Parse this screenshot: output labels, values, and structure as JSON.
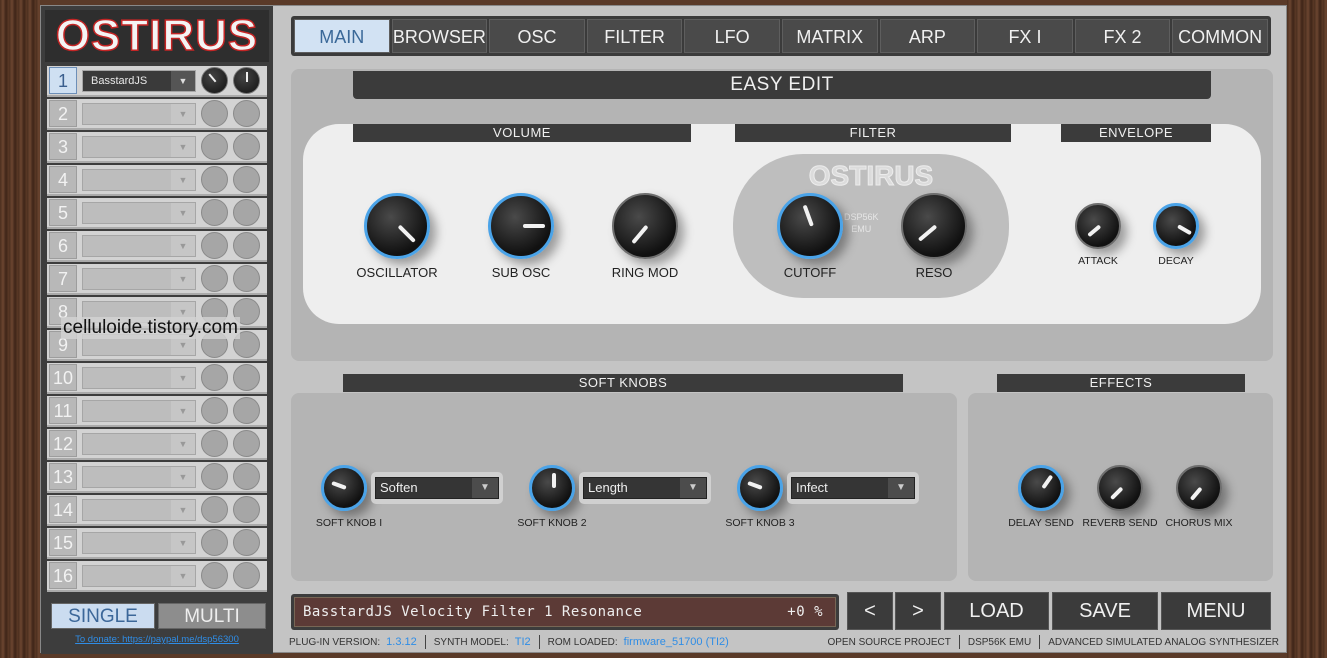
{
  "app": {
    "logo": "OSTIRUS"
  },
  "parts": [
    {
      "num": "1",
      "preset": "BasstardJS"
    },
    {
      "num": "2",
      "preset": ""
    },
    {
      "num": "3",
      "preset": ""
    },
    {
      "num": "4",
      "preset": ""
    },
    {
      "num": "5",
      "preset": ""
    },
    {
      "num": "6",
      "preset": ""
    },
    {
      "num": "7",
      "preset": ""
    },
    {
      "num": "8",
      "preset": ""
    },
    {
      "num": "9",
      "preset": ""
    },
    {
      "num": "10",
      "preset": ""
    },
    {
      "num": "11",
      "preset": ""
    },
    {
      "num": "12",
      "preset": ""
    },
    {
      "num": "13",
      "preset": ""
    },
    {
      "num": "14",
      "preset": ""
    },
    {
      "num": "15",
      "preset": ""
    },
    {
      "num": "16",
      "preset": ""
    }
  ],
  "watermark": "celluloide.tistory.com",
  "mode": {
    "single": "SINGLE",
    "multi": "MULTI"
  },
  "donate": "To donate: https://paypal.me/dsp56300",
  "tabs": [
    "MAIN",
    "BROWSER",
    "OSC",
    "FILTER",
    "LFO",
    "MATRIX",
    "ARP",
    "FX I",
    "FX 2",
    "COMMON"
  ],
  "easy_edit": {
    "title": "EASY EDIT",
    "volume": "VOLUME",
    "filter": "FILTER",
    "envelope": "ENVELOPE",
    "knobs": {
      "oscillator": "OSCILLATOR",
      "sub_osc": "SUB OSC",
      "ring_mod": "RING MOD",
      "cutoff": "CUTOFF",
      "reso": "RESO",
      "attack": "ATTACK",
      "decay": "DECAY"
    },
    "filter_logo": "OSTIRUS",
    "dsp_line1": "DSP56K",
    "dsp_line2": "EMU"
  },
  "soft_knobs": {
    "title": "SOFT KNOBS",
    "k1": {
      "label": "SOFT KNOB I",
      "value": "Soften"
    },
    "k2": {
      "label": "SOFT KNOB 2",
      "value": "Length"
    },
    "k3": {
      "label": "SOFT KNOB 3",
      "value": "Infect"
    }
  },
  "effects": {
    "title": "EFFECTS",
    "delay": "DELAY SEND",
    "reverb": "REVERB SEND",
    "chorus": "CHORUS MIX"
  },
  "lcd": {
    "text": "BasstardJS  Velocity  Filter 1 Resonance",
    "value": "+0 %"
  },
  "buttons": {
    "prev": "<",
    "next": ">",
    "load": "LOAD",
    "save": "SAVE",
    "menu": "MENU"
  },
  "status": {
    "plugin_label": "PLUG-IN VERSION:",
    "plugin_version": "1.3.12",
    "model_label": "SYNTH MODEL:",
    "model": "TI2",
    "rom_label": "ROM LOADED:",
    "rom": "firmware_51700 (TI2)",
    "open_source": "OPEN SOURCE PROJECT",
    "emu": "DSP56K EMU",
    "advanced": "ADVANCED SIMULATED ANALOG SYNTHESIZER"
  }
}
